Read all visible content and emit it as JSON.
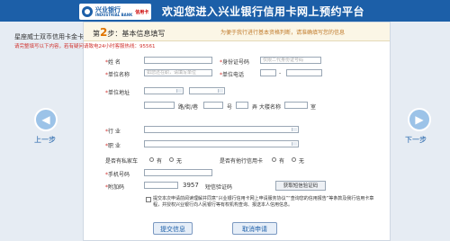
{
  "banner": {
    "logo_text": "兴业银行",
    "logo_sub": "INDUSTRIAL BANK",
    "logo_card": "信用卡",
    "title": "欢迎您进入兴业银行信用卡网上预约平台"
  },
  "nav": {
    "prev_label": "上一步",
    "next_label": "下一步"
  },
  "step": {
    "number": "2",
    "title": "步：基本信息填写",
    "hint": "为便于我行进行基本资格判断，请准确填写您的信息"
  },
  "card_name": "星座威士双币信用卡金卡",
  "notice": "请完整填写以下内容，若有疑问请致电24小时客服热线：95561",
  "fields": {
    "name": "姓 名",
    "id_no": "身份证号码",
    "id_placeholder": "仅限二代身份证号码",
    "company": "单位名称",
    "company_placeholder": "如您还在职，请填写单位",
    "company_phone": "单位电话",
    "company_addr": "单位地址",
    "addr_road": "路/街/巷",
    "addr_no": "号",
    "addr_room": "弄",
    "addr_building": "大楼名称",
    "addr_unit": "室",
    "industry": "行 业",
    "job": "职 业",
    "has_car": "是否有私家车",
    "has_card": "是否有他行信用卡",
    "yes": "有",
    "no": "无",
    "mobile": "手机号码",
    "extra_code": "附加码",
    "captcha_value": "3957",
    "sms_code": "短信验证码",
    "get_code": "获取短信验证码"
  },
  "terms": "提交本次申请前阅读理解并同意“兴业银行信用卡网上申请服务协议”“查询您的信用报告”等条款及我行信用卡章程，并授权兴业银行向人民银行等有权机构查询、报送本人信用信息。",
  "buttons": {
    "submit": "提交信息",
    "cancel": "取消申请"
  }
}
